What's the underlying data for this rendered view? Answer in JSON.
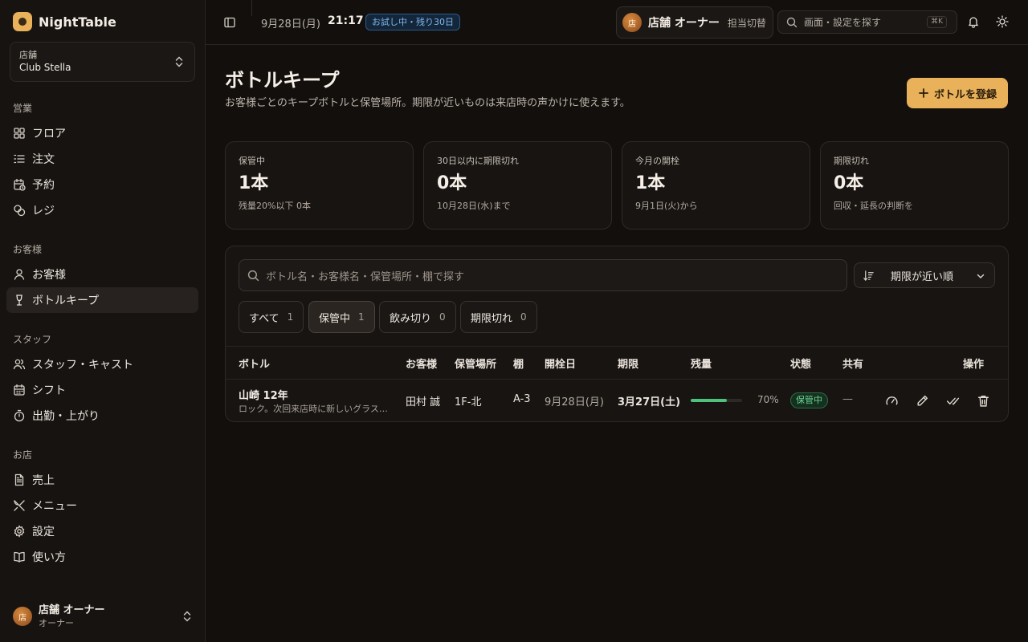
{
  "app": {
    "name": "NightTable"
  },
  "store": {
    "label": "店舗",
    "value": "Club Stella"
  },
  "nav": {
    "sections": [
      {
        "title": "営業",
        "items": [
          {
            "label": "フロア",
            "icon": "grid-icon"
          },
          {
            "label": "注文",
            "icon": "list-icon"
          },
          {
            "label": "予約",
            "icon": "calendar-clock-icon"
          },
          {
            "label": "レジ",
            "icon": "coins-icon"
          }
        ]
      },
      {
        "title": "お客様",
        "items": [
          {
            "label": "お客様",
            "icon": "user-icon"
          },
          {
            "label": "ボトルキープ",
            "icon": "wine-icon",
            "active": true
          }
        ]
      },
      {
        "title": "スタッフ",
        "items": [
          {
            "label": "スタッフ・キャスト",
            "icon": "users-icon"
          },
          {
            "label": "シフト",
            "icon": "calendar-icon"
          },
          {
            "label": "出勤・上がり",
            "icon": "timer-icon"
          }
        ]
      },
      {
        "title": "お店",
        "items": [
          {
            "label": "売上",
            "icon": "file-text-icon"
          },
          {
            "label": "メニュー",
            "icon": "utensils-icon"
          },
          {
            "label": "設定",
            "icon": "gear-icon"
          },
          {
            "label": "使い方",
            "icon": "book-icon"
          }
        ]
      }
    ]
  },
  "footer_user": {
    "avatar": "店",
    "name": "店舗 オーナー",
    "role": "オーナー"
  },
  "topbar": {
    "date": "9月28日(月)",
    "time": "21:17",
    "trial_badge": "お試し中・残り30日",
    "staff": {
      "avatar": "店",
      "name": "店舗 オーナー",
      "switch_label": "担当切替"
    },
    "search_placeholder": "画面・設定を探す",
    "search_shortcut": "⌘K"
  },
  "page": {
    "title": "ボトルキープ",
    "subtitle": "お客様ごとのキープボトルと保管場所。期限が近いものは来店時の声かけに使えます。",
    "add_button": "ボトルを登録"
  },
  "stats": [
    {
      "label": "保管中",
      "value": "1本",
      "note": "残量20%以下 0本"
    },
    {
      "label": "30日以内に期限切れ",
      "value": "0本",
      "note": "10月28日(水)まで"
    },
    {
      "label": "今月の開栓",
      "value": "1本",
      "note": "9月1日(火)から"
    },
    {
      "label": "期限切れ",
      "value": "0本",
      "note": "回収・延長の判断を"
    }
  ],
  "panel": {
    "search_placeholder": "ボトル名・お客様名・保管場所・棚で探す",
    "sort_label": "期限が近い順",
    "filters": [
      {
        "label": "すべて",
        "count": "1"
      },
      {
        "label": "保管中",
        "count": "1",
        "active": true
      },
      {
        "label": "飲み切り",
        "count": "0"
      },
      {
        "label": "期限切れ",
        "count": "0"
      }
    ],
    "columns": [
      "ボトル",
      "お客様",
      "保管場所",
      "棚",
      "開栓日",
      "期限",
      "残量",
      "状態",
      "共有",
      "操作"
    ],
    "rows": [
      {
        "bottle": "山崎 12年",
        "note": "ロック。次回来店時に新しいグラスを用意",
        "customer": "田村 誠",
        "location": "1F-北",
        "shelf": "A-3",
        "opened": "9月28日(月)",
        "expires": "3月27日(土)",
        "remaining_pct": 70,
        "remaining_label": "70%",
        "status": "保管中",
        "shared": "—"
      }
    ]
  },
  "colors": {
    "accent": "#e8b15a",
    "background": "#120f0d",
    "status_green": "#4cc27a",
    "badge_blue": "#7fb6ee"
  }
}
